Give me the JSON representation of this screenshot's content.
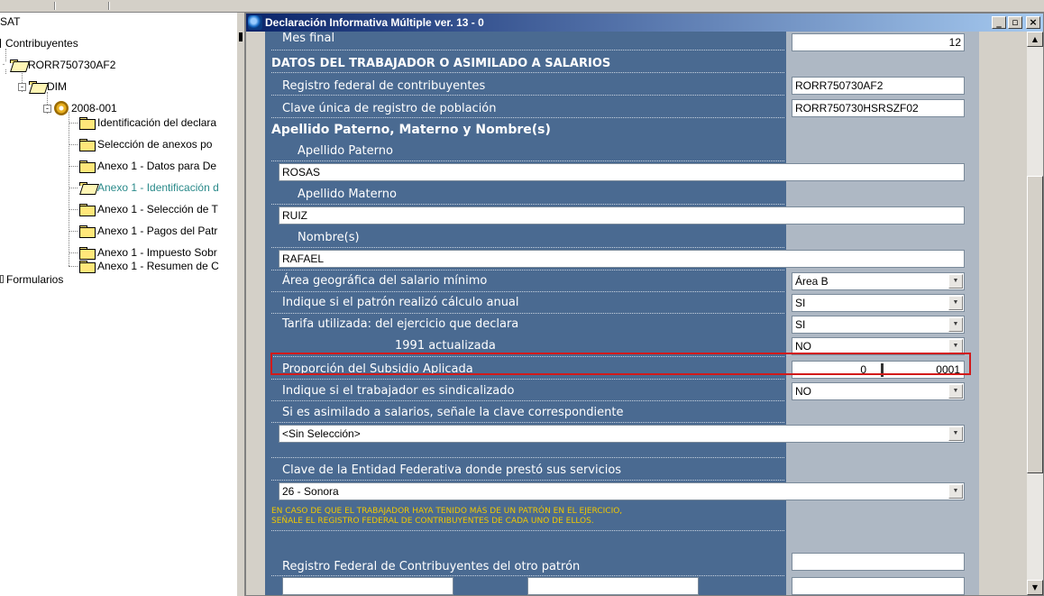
{
  "tree": {
    "root": "SAT",
    "items": [
      {
        "label": "Contribuyentes"
      },
      {
        "label": "RORR750730AF2"
      },
      {
        "label": "DIM"
      },
      {
        "label": "2008-001"
      },
      {
        "label": "Identificación del declara"
      },
      {
        "label": "Selección de anexos po"
      },
      {
        "label": "Anexo 1 - Datos para De"
      },
      {
        "label": "Anexo 1 - Identificación d"
      },
      {
        "label": "Anexo 1 - Selección de T"
      },
      {
        "label": "Anexo 1 - Pagos del Patr"
      },
      {
        "label": "Anexo 1 - Impuesto Sobr"
      },
      {
        "label": "Anexo 1 - Resumen de C"
      },
      {
        "label": "Formularios"
      }
    ]
  },
  "window": {
    "title": "Declaración Informativa Múltiple ver. 13 - 0",
    "btn_min": "_",
    "btn_restore": "▫",
    "btn_close": "×"
  },
  "form": {
    "mes_final_label": "Mes final",
    "mes_final_value": "12",
    "section_title": "DATOS DEL TRABAJADOR O ASIMILADO A SALARIOS",
    "rfc_label": "Registro federal de contribuyentes",
    "rfc_value": "RORR750730AF2",
    "curp_label": "Clave única de registro de población",
    "curp_value": "RORR750730HSRSZF02",
    "nombre_header": "Apellido Paterno, Materno y Nombre(s)",
    "paterno_label": "Apellido Paterno",
    "paterno_value": "ROSAS",
    "materno_label": "Apellido Materno",
    "materno_value": "RUIZ",
    "nombre_label": "Nombre(s)",
    "nombre_value": "RAFAEL",
    "area_label": "Área geográfica del salario mínimo",
    "area_value": "Área B",
    "calculo_label": "Indique si el patrón realizó cálculo anual",
    "calculo_value": "SI",
    "tarifa_label": "Tarifa utilizada: del ejercicio que declara",
    "tarifa_value": "SI",
    "tarifa1991_label": "1991 actualizada",
    "tarifa1991_value": "NO",
    "proporcion_label": "Proporción del Subsidio Aplicada",
    "proporcion_int": "0",
    "proporcion_dec": "0001",
    "sindicalizado_label": "Indique si el trabajador es sindicalizado",
    "sindicalizado_value": "NO",
    "asimilado_label": "Si es asimilado a salarios, señale la clave correspondiente",
    "asimilado_value": "<Sin Selección>",
    "entidad_label": "Clave de la Entidad Federativa donde prestó sus servicios",
    "entidad_value": "26 - Sonora",
    "warning_line1": "EN CASO DE QUE EL TRABAJADOR HAYA TENIDO MÁS DE UN PATRÓN EN EL EJERCICIO,",
    "warning_line2": "SEÑALE EL REGISTRO FEDERAL DE CONTRIBUYENTES DE CADA UNO DE ELLOS.",
    "otro_patron_label": "Registro Federal de Contribuyentes del otro patrón"
  },
  "colors": {
    "form_bg": "#4a6a91",
    "gray_column": "#aeb8c4",
    "highlight": "#d21a1a",
    "warning_text": "#f0c800",
    "title_gradient_start": "#0a246a"
  }
}
